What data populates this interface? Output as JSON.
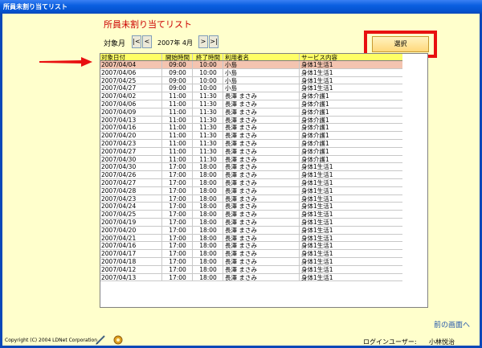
{
  "window": {
    "title": "所員未割り当てリスト"
  },
  "page": {
    "heading": "所員未割り当てリスト"
  },
  "period": {
    "label": "対象月",
    "value": "2007年 4月",
    "first_btn": "|<",
    "prev_btn": "<",
    "next_btn": ">",
    "last_btn": ">|"
  },
  "select_button": {
    "label": "選択"
  },
  "table": {
    "columns": [
      "対象日付",
      "開始時間",
      "終了時間",
      "利用者名",
      "サービス内容"
    ],
    "rows": [
      [
        "2007/04/04",
        "09:00",
        "10:00",
        "小島",
        "身体1生活1"
      ],
      [
        "2007/04/06",
        "09:00",
        "10:00",
        "小島",
        "身体1生活1"
      ],
      [
        "2007/04/25",
        "09:00",
        "10:00",
        "小島",
        "身体1生活1"
      ],
      [
        "2007/04/27",
        "09:00",
        "10:00",
        "小島",
        "身体1生活1"
      ],
      [
        "2007/04/02",
        "11:00",
        "11:30",
        "長澤 まさみ",
        "身体介護1"
      ],
      [
        "2007/04/06",
        "11:00",
        "11:30",
        "長澤 まさみ",
        "身体介護1"
      ],
      [
        "2007/04/09",
        "11:00",
        "11:30",
        "長澤 まさみ",
        "身体介護1"
      ],
      [
        "2007/04/13",
        "11:00",
        "11:30",
        "長澤 まさみ",
        "身体介護1"
      ],
      [
        "2007/04/16",
        "11:00",
        "11:30",
        "長澤 まさみ",
        "身体介護1"
      ],
      [
        "2007/04/20",
        "11:00",
        "11:30",
        "長澤 まさみ",
        "身体介護1"
      ],
      [
        "2007/04/23",
        "11:00",
        "11:30",
        "長澤 まさみ",
        "身体介護1"
      ],
      [
        "2007/04/27",
        "11:00",
        "11:30",
        "長澤 まさみ",
        "身体介護1"
      ],
      [
        "2007/04/30",
        "11:00",
        "11:30",
        "長澤 まさみ",
        "身体介護1"
      ],
      [
        "2007/04/30",
        "17:00",
        "18:00",
        "長澤 まさみ",
        "身体1生活1"
      ],
      [
        "2007/04/26",
        "17:00",
        "18:00",
        "長澤 まさみ",
        "身体1生活1"
      ],
      [
        "2007/04/27",
        "17:00",
        "18:00",
        "長澤 まさみ",
        "身体1生活1"
      ],
      [
        "2007/04/28",
        "17:00",
        "18:00",
        "長澤 まさみ",
        "身体1生活1"
      ],
      [
        "2007/04/23",
        "17:00",
        "18:00",
        "長澤 まさみ",
        "身体1生活1"
      ],
      [
        "2007/04/24",
        "17:00",
        "18:00",
        "長澤 まさみ",
        "身体1生活1"
      ],
      [
        "2007/04/25",
        "17:00",
        "18:00",
        "長澤 まさみ",
        "身体1生活1"
      ],
      [
        "2007/04/19",
        "17:00",
        "18:00",
        "長澤 まさみ",
        "身体1生活1"
      ],
      [
        "2007/04/20",
        "17:00",
        "18:00",
        "長澤 まさみ",
        "身体1生活1"
      ],
      [
        "2007/04/21",
        "17:00",
        "18:00",
        "長澤 まさみ",
        "身体1生活1"
      ],
      [
        "2007/04/16",
        "17:00",
        "18:00",
        "長澤 まさみ",
        "身体1生活1"
      ],
      [
        "2007/04/17",
        "17:00",
        "18:00",
        "長澤 まさみ",
        "身体1生活1"
      ],
      [
        "2007/04/18",
        "17:00",
        "18:00",
        "長澤 まさみ",
        "身体1生活1"
      ],
      [
        "2007/04/12",
        "17:00",
        "18:00",
        "長澤 まさみ",
        "身体1生活1"
      ],
      [
        "2007/04/13",
        "17:00",
        "18:00",
        "長澤 まさみ",
        "身体1生活1"
      ]
    ],
    "selected_row": 0
  },
  "footer": {
    "prev_screen": "前の画面へ",
    "copyright": "Copyright (C) 2004 LDNet Corporation",
    "login_label": "ログインユーザー:",
    "login_user": "小林悦治"
  },
  "colors": {
    "accent_red": "#e81010",
    "selected_row": "#f4c4b0",
    "header_row": "#ffff66"
  },
  "icons": [
    "pen-icon",
    "coin-icon"
  ]
}
